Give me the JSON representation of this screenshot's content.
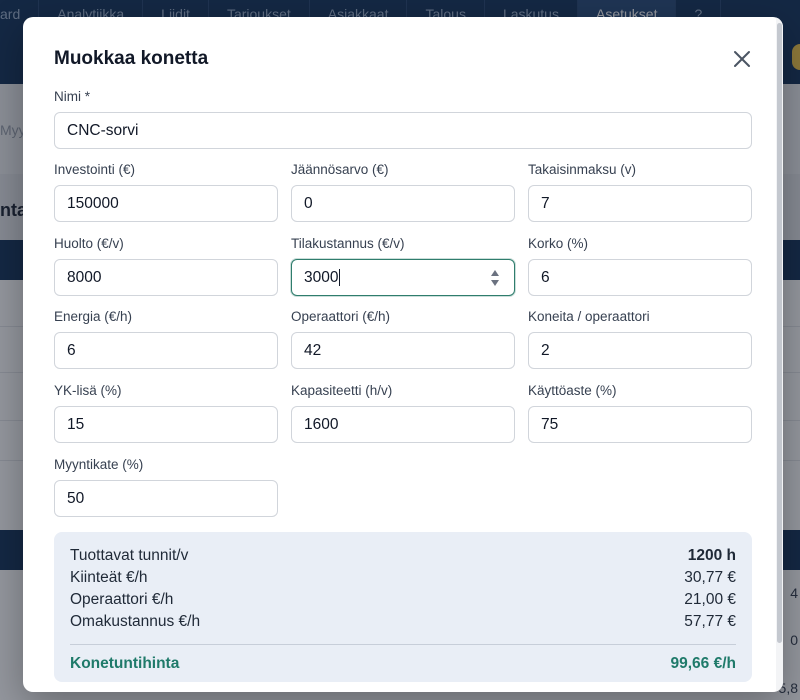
{
  "background": {
    "tabs": [
      {
        "label": "ard",
        "active": false
      },
      {
        "label": "Analytiikka",
        "active": false
      },
      {
        "label": "Liidit",
        "active": false
      },
      {
        "label": "Tarjoukset",
        "active": false
      },
      {
        "label": "Asiakkaat",
        "active": false
      },
      {
        "label": "Talous",
        "active": false
      },
      {
        "label": "Laskutus",
        "active": false
      },
      {
        "label": "Asetukset",
        "active": true
      },
      {
        "label": "?",
        "active": false
      }
    ],
    "search_fragment": "Myy",
    "heading_fragment": "nta",
    "right_values": [
      "4",
      "0",
      "5,8"
    ]
  },
  "modal": {
    "title": "Muokkaa konetta",
    "fields": {
      "name": {
        "label": "Nimi *",
        "value": "CNC-sorvi"
      },
      "investment": {
        "label": "Investointi (€)",
        "value": "150000"
      },
      "residual": {
        "label": "Jäännösarvo (€)",
        "value": "0"
      },
      "payback": {
        "label": "Takaisinmaksu (v)",
        "value": "7"
      },
      "maintenance": {
        "label": "Huolto (€/v)",
        "value": "8000"
      },
      "space_cost": {
        "label": "Tilakustannus (€/v)",
        "value": "3000"
      },
      "interest": {
        "label": "Korko (%)",
        "value": "6"
      },
      "energy": {
        "label": "Energia (€/h)",
        "value": "6"
      },
      "operator": {
        "label": "Operaattori (€/h)",
        "value": "42"
      },
      "machines_per_operator": {
        "label": "Koneita / operaattori",
        "value": "2"
      },
      "overhead": {
        "label": "YK-lisä (%)",
        "value": "15"
      },
      "capacity": {
        "label": "Kapasiteetti (h/v)",
        "value": "1600"
      },
      "utilization": {
        "label": "Käyttöaste (%)",
        "value": "75"
      },
      "sales_margin": {
        "label": "Myyntikate (%)",
        "value": "50"
      }
    },
    "summary": {
      "productive_hours": {
        "label": "Tuottavat tunnit/v",
        "value": "1200 h"
      },
      "fixed": {
        "label": "Kiinteät €/h",
        "value": "30,77 €"
      },
      "operator": {
        "label": "Operaattori €/h",
        "value": "21,00 €"
      },
      "own_cost": {
        "label": "Omakustannus €/h",
        "value": "57,77 €"
      },
      "hourly_price": {
        "label": "Konetuntihinta",
        "value": "99,66 €/h"
      }
    }
  },
  "colors": {
    "nav": "#16355c",
    "accent": "#1f7a6a",
    "summary_bg": "#e9eef6"
  }
}
